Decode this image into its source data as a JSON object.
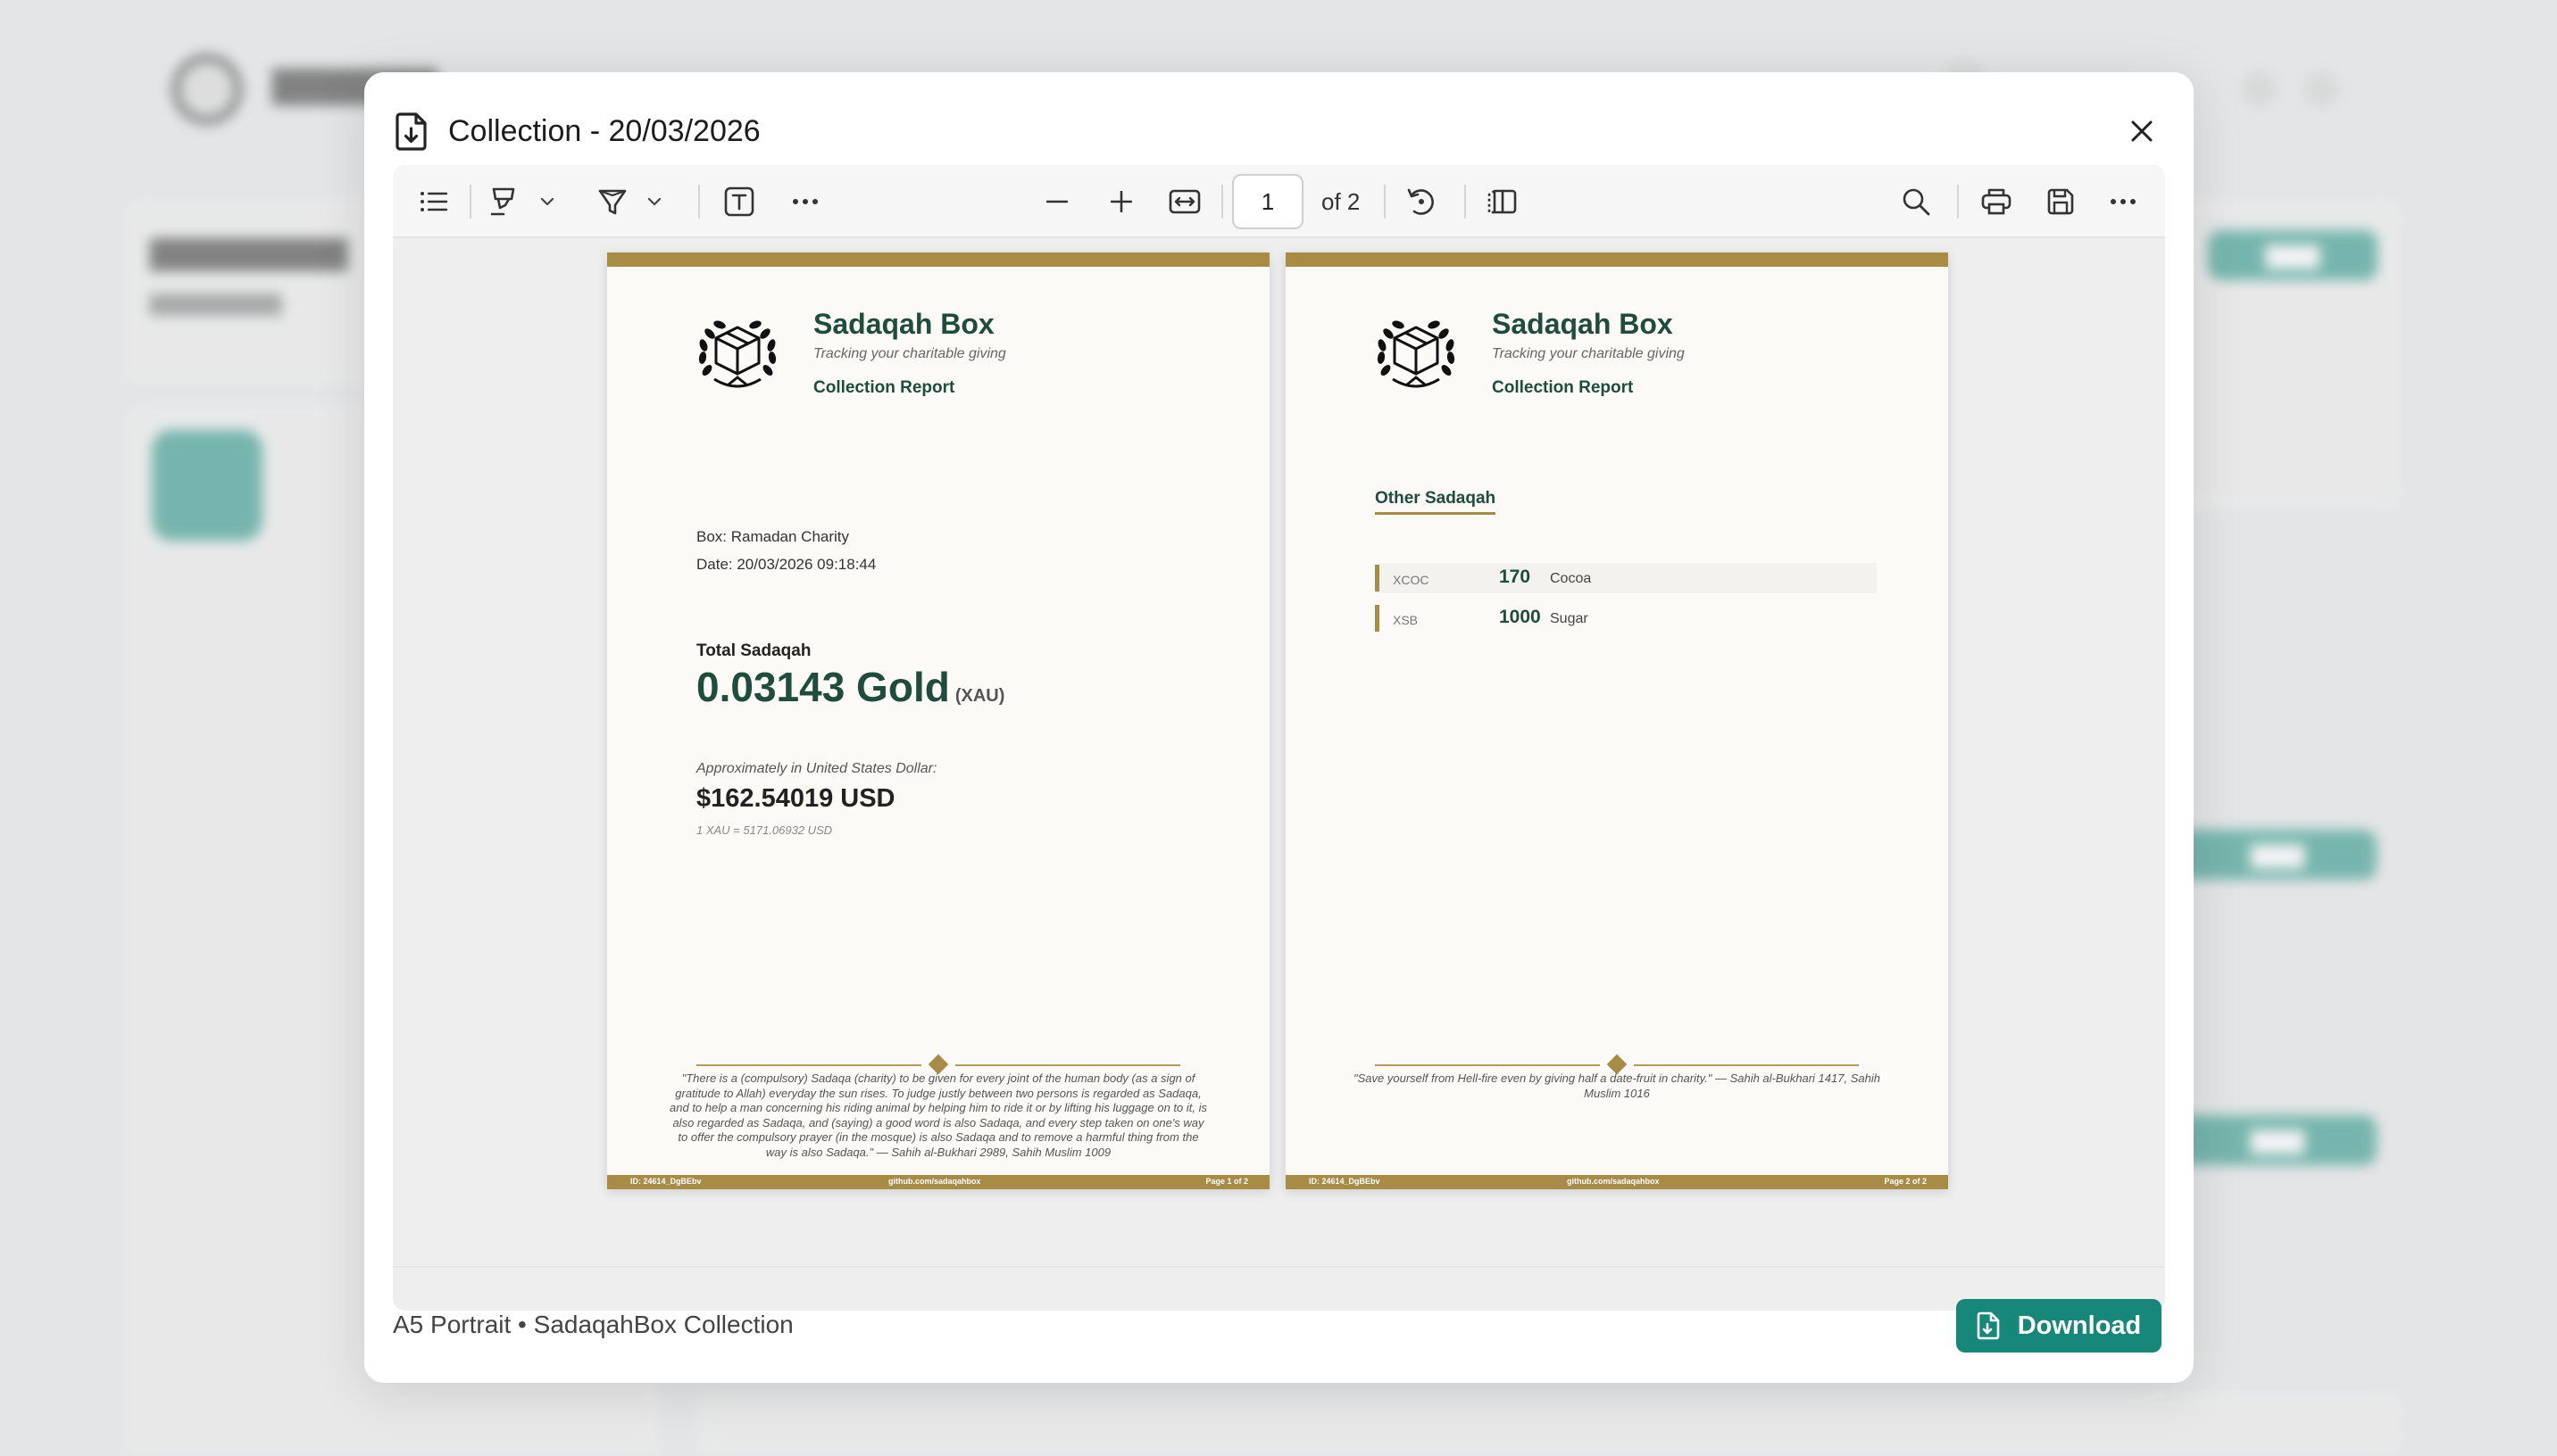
{
  "modal": {
    "title": "Collection - 20/03/2026",
    "footer_info": "A5 Portrait • SadaqahBox Collection",
    "download_label": "Download"
  },
  "toolbar": {
    "page_number": "1",
    "page_of": "of 2"
  },
  "pages": [
    {
      "brand": "Sadaqah Box",
      "tagline": "Tracking your charitable giving",
      "report_title": "Collection Report",
      "box_line": "Box: Ramadan Charity",
      "date_line": "Date: 20/03/2026 09:18:44",
      "total_label": "Total Sadaqah",
      "total_amount": "0.03143 Gold",
      "total_code": "(XAU)",
      "approx_label": "Approximately in United States Dollar:",
      "approx_value": "$162.54019 USD",
      "rate": "1 XAU = 5171.06932 USD",
      "quote": "\"There is a (compulsory) Sadaqa (charity) to be given for every joint of the human body (as a sign of gratitude to Allah) everyday the sun rises. To judge justly between two persons is regarded as Sadaqa, and to help a man concerning his riding animal by helping him to ride it or by lifting his luggage on to it, is also regarded as Sadaqa, and (saying) a good word is also Sadaqa, and every step taken on one's way to offer the compulsory prayer (in the mosque) is also Sadaqa and to remove a harmful thing from the way is also Sadaqa.\" — Sahih al-Bukhari 2989, Sahih Muslim 1009",
      "footer_id": "ID: 24614_DgBEbv",
      "footer_site": "github.com/sadaqahbox",
      "footer_page": "Page 1 of 2"
    },
    {
      "brand": "Sadaqah Box",
      "tagline": "Tracking your charitable giving",
      "report_title": "Collection Report",
      "section_title": "Other Sadaqah",
      "items": [
        {
          "code": "XCOC",
          "qty": "170",
          "name": "Cocoa"
        },
        {
          "code": "XSB",
          "qty": "1000",
          "name": "Sugar"
        }
      ],
      "quote": "\"Save yourself from Hell-fire even by giving half a date-fruit in charity.\" — Sahih al-Bukhari 1417, Sahih Muslim 1016",
      "footer_id": "ID: 24614_DgBEbv",
      "footer_site": "github.com/sadaqahbox",
      "footer_page": "Page 2 of 2"
    }
  ],
  "colors": {
    "accent_teal": "#17877a",
    "pdf_gold": "#a88c46",
    "pdf_green": "#1f4c3d"
  }
}
